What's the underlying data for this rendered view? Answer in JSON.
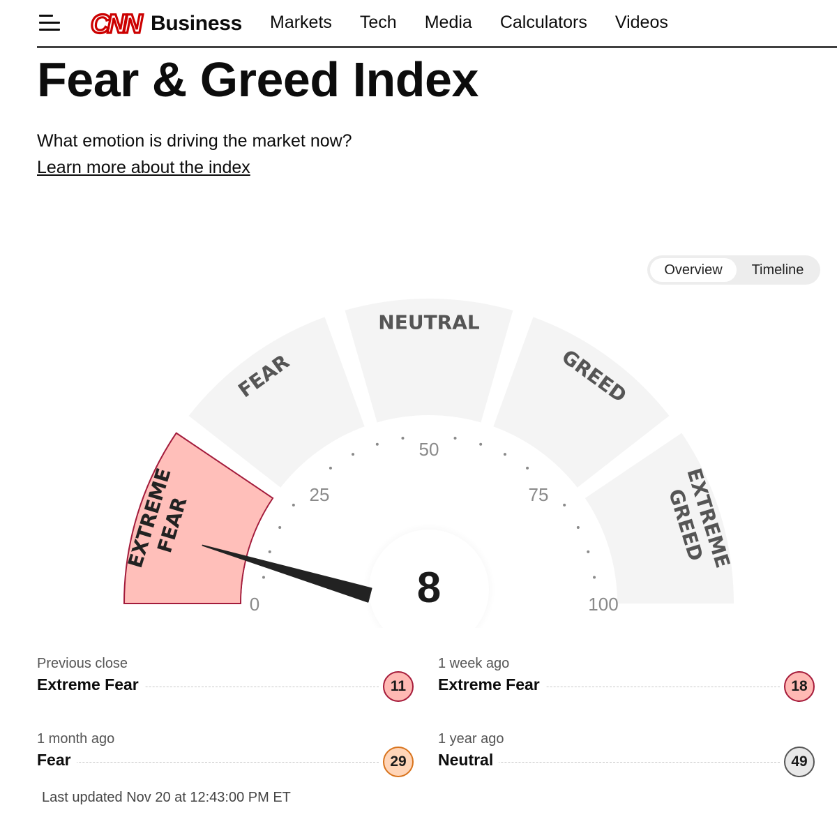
{
  "header": {
    "brand": "Business",
    "nav": [
      "Markets",
      "Tech",
      "Media",
      "Calculators",
      "Videos"
    ]
  },
  "title": "Fear & Greed Index",
  "subtitle": "What emotion is driving the market now?",
  "learn_more": "Learn more about the index",
  "toggle": {
    "overview": "Overview",
    "timeline": "Timeline"
  },
  "gauge": {
    "value": 8,
    "value_text": "8",
    "segments": [
      "EXTREME FEAR",
      "FEAR",
      "NEUTRAL",
      "GREED",
      "EXTREME GREED"
    ],
    "active_segment": "EXTREME FEAR",
    "ticks": [
      "0",
      "25",
      "50",
      "75",
      "100"
    ]
  },
  "stats": [
    {
      "label": "Previous close",
      "rating": "Extreme Fear",
      "value": "11",
      "level": "efear"
    },
    {
      "label": "1 week ago",
      "rating": "Extreme Fear",
      "value": "18",
      "level": "efear"
    },
    {
      "label": "1 month ago",
      "rating": "Fear",
      "value": "29",
      "level": "fear"
    },
    {
      "label": "1 year ago",
      "rating": "Neutral",
      "value": "49",
      "level": "neutral"
    }
  ],
  "last_updated": "Last updated Nov 20 at 12:43:00 PM ET",
  "colors": {
    "extreme_fear_fill": "#ffbfba",
    "extreme_fear_stroke": "#a31b3b",
    "segment_fill": "#f4f4f4",
    "cnn_red": "#cc0000"
  }
}
